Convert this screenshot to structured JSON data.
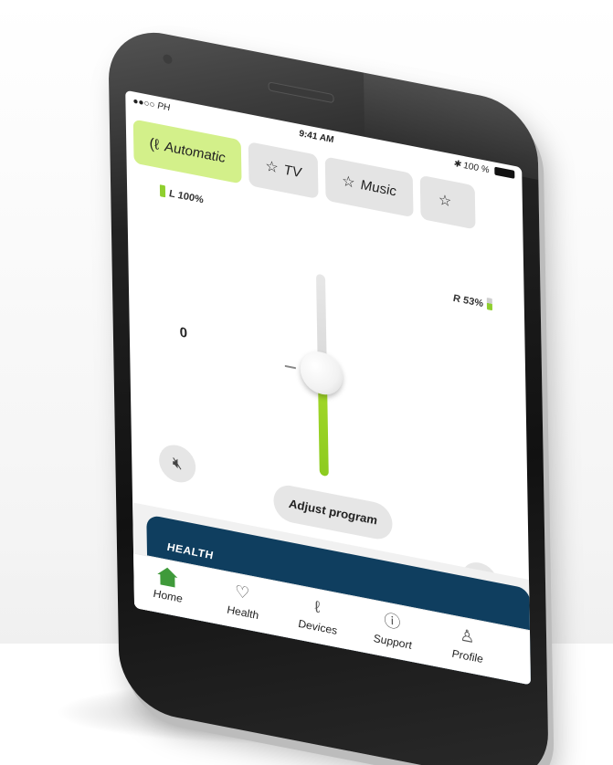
{
  "status_bar": {
    "carrier": "●●○○ PH",
    "time": "9:41 AM",
    "battery": "100 %"
  },
  "programs": [
    {
      "label": "Automatic",
      "icon": "ear-icon",
      "active": true
    },
    {
      "label": "TV",
      "icon": "star-icon",
      "active": false
    },
    {
      "label": "Music",
      "icon": "star-icon",
      "active": false
    }
  ],
  "battery": {
    "left_label": "L 100%",
    "left_level": 1.0,
    "right_label": "R 53%",
    "right_level": 0.53
  },
  "volume": {
    "value": "0",
    "level": 0.5
  },
  "controls": {
    "mute_icon": "speaker-muted-icon",
    "adjust_label": "Adjust program",
    "equalizer_icon": "sliders-icon"
  },
  "health_card": {
    "title": "HEALTH"
  },
  "nav": [
    {
      "label": "Home",
      "icon": "home-icon",
      "active": true
    },
    {
      "label": "Health",
      "icon": "heart-icon",
      "active": false
    },
    {
      "label": "Devices",
      "icon": "hearing-aid-icon",
      "active": false
    },
    {
      "label": "Support",
      "icon": "help-icon",
      "active": false
    },
    {
      "label": "Profile",
      "icon": "person-icon",
      "active": false
    }
  ],
  "colors": {
    "accent_green": "#d3f08a",
    "slider_green": "#8ccb1f",
    "health_navy": "#0f3e5f",
    "nav_active": "#3f9a3a"
  }
}
